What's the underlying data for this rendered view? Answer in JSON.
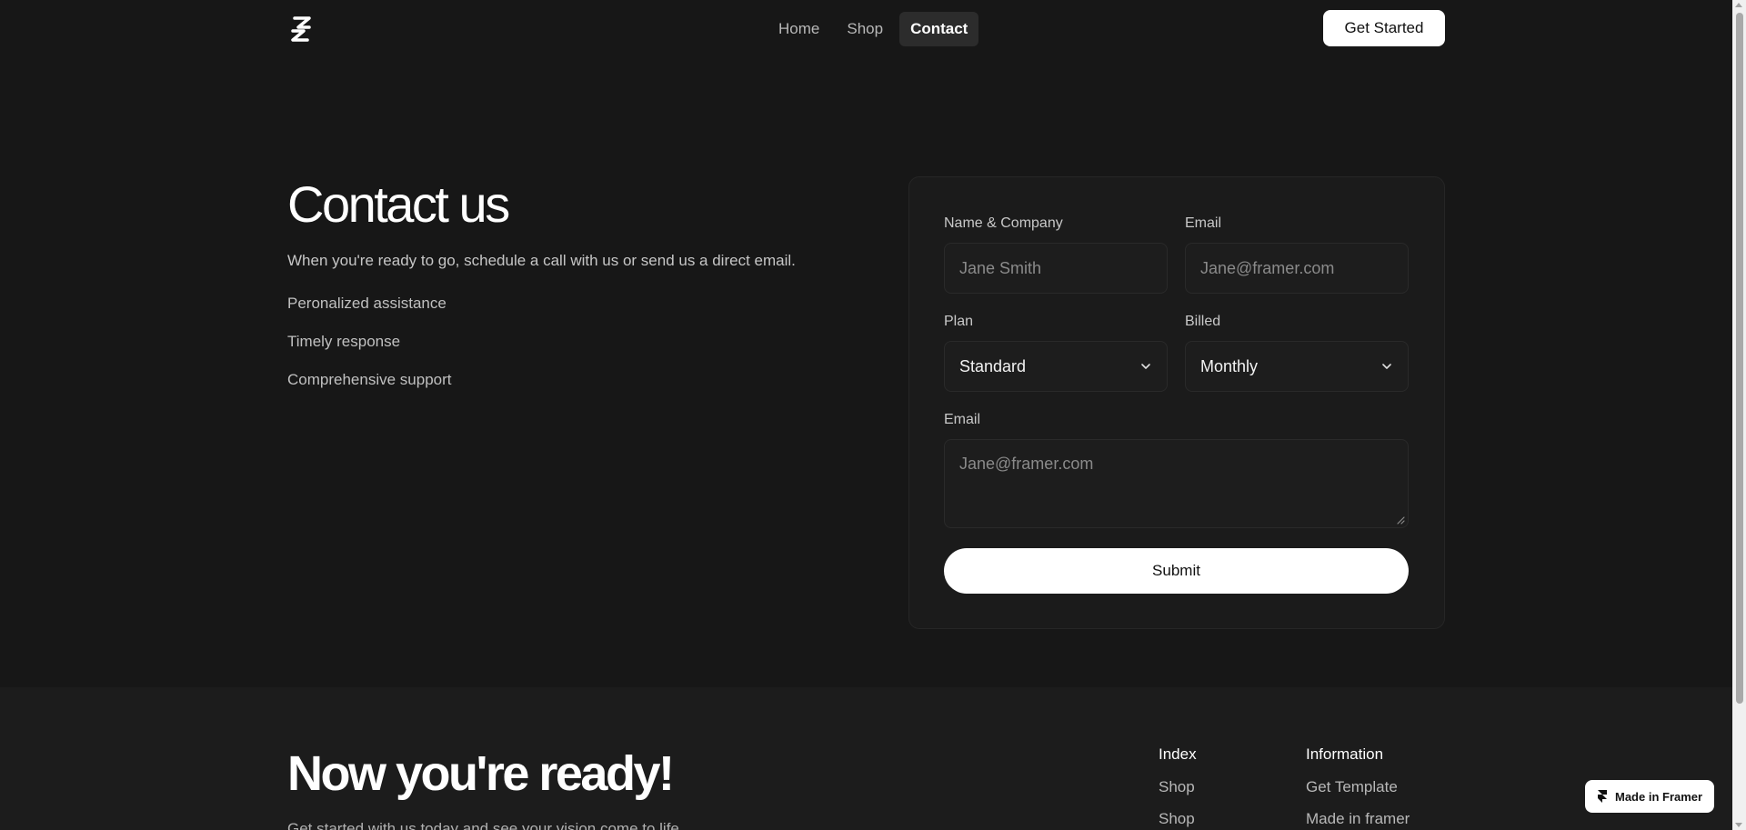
{
  "header": {
    "logo_icon": "s-logo-icon",
    "nav": [
      "Home",
      "Shop",
      "Contact"
    ],
    "active_nav": "Contact",
    "cta": "Get Started"
  },
  "hero": {
    "title": "Contact us",
    "subtitle": "When you're ready to go, schedule a call with us or send us a direct email.",
    "features": [
      "Peronalized assistance",
      "Timely response",
      "Comprehensive support"
    ]
  },
  "form": {
    "name_label": "Name & Company",
    "name_placeholder": "Jane Smith",
    "email_label": "Email",
    "email_placeholder": "Jane@framer.com",
    "plan_label": "Plan",
    "plan_value": "Standard",
    "billed_label": "Billed",
    "billed_value": "Monthly",
    "message_label": "Email",
    "message_placeholder": "Jane@framer.com",
    "submit": "Submit"
  },
  "footer": {
    "title": "Now you're ready!",
    "subtitle": "Get started with us today and see your vision come to life.",
    "columns": [
      {
        "heading": "Index",
        "links": [
          "Shop",
          "Shop"
        ]
      },
      {
        "heading": "Information",
        "links": [
          "Get Template",
          "Made in framer"
        ]
      }
    ]
  },
  "badge": {
    "label": "Made in Framer",
    "icon": "framer-icon"
  },
  "colors": {
    "background": "#171717",
    "card": "#1b1b1b",
    "accent": "#ffffff"
  }
}
